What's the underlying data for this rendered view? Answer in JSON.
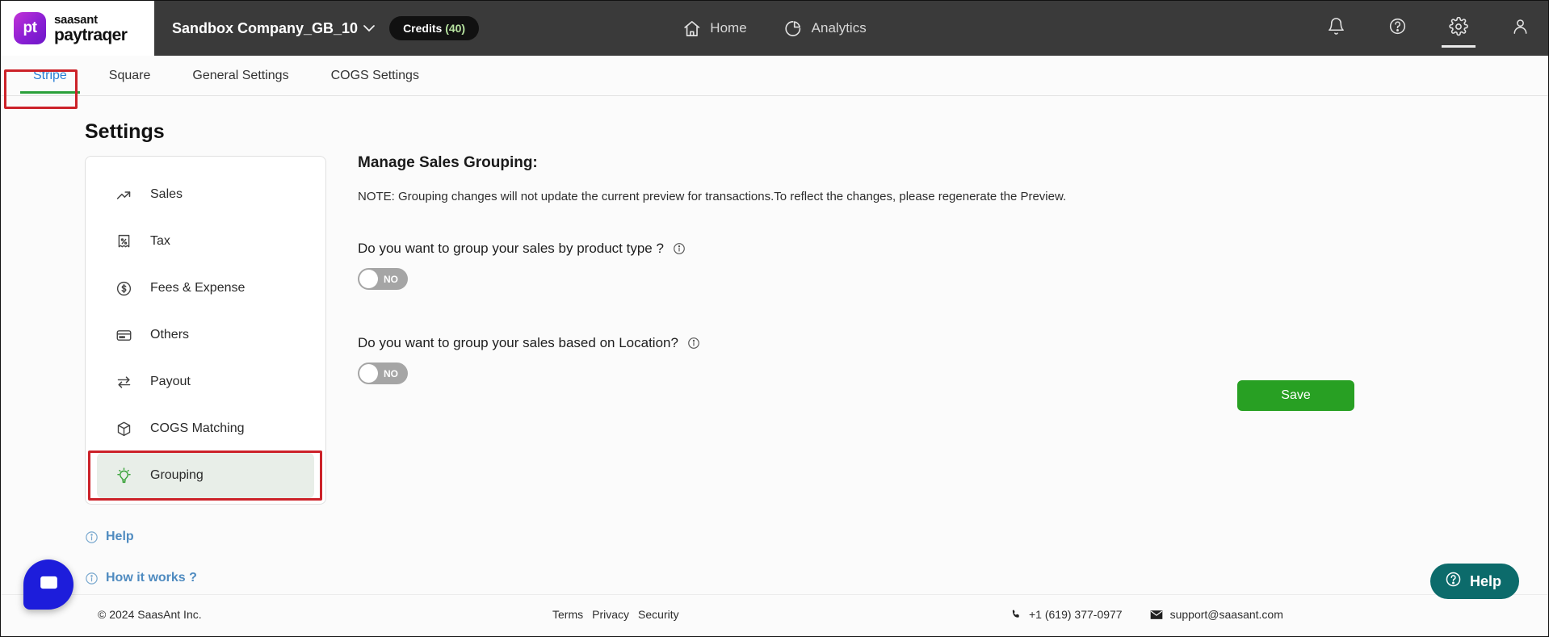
{
  "topbar": {
    "logo_mark": "pt",
    "logo_line1": "saasant",
    "logo_line2": "paytraqer",
    "company": "Sandbox Company_GB_10",
    "company_chevron": "chevron-down",
    "credits_label": "Credits",
    "credits_count": "(40)",
    "nav": [
      {
        "label": "Home",
        "icon": "home-icon"
      },
      {
        "label": "Analytics",
        "icon": "pie-chart-icon"
      }
    ],
    "right_icons": [
      {
        "name": "bell-icon",
        "active": false
      },
      {
        "name": "help-circle-icon",
        "active": false
      },
      {
        "name": "gear-icon",
        "active": true
      },
      {
        "name": "user-icon",
        "active": false
      }
    ]
  },
  "tabs": [
    {
      "label": "Stripe",
      "active": true,
      "highlighted": true
    },
    {
      "label": "Square",
      "active": false,
      "highlighted": false
    },
    {
      "label": "General Settings",
      "active": false,
      "highlighted": false
    },
    {
      "label": "COGS Settings",
      "active": false,
      "highlighted": false
    }
  ],
  "page": {
    "title": "Settings"
  },
  "sidebar": {
    "items": [
      {
        "label": "Sales",
        "icon": "trending-up-icon",
        "selected": false
      },
      {
        "label": "Tax",
        "icon": "receipt-percent-icon",
        "selected": false
      },
      {
        "label": "Fees & Expense",
        "icon": "dollar-circle-icon",
        "selected": false
      },
      {
        "label": "Others",
        "icon": "card-icon",
        "selected": false
      },
      {
        "label": "Payout",
        "icon": "transfer-arrows-icon",
        "selected": false
      },
      {
        "label": "COGS Matching",
        "icon": "box-icon",
        "selected": false
      },
      {
        "label": "Grouping",
        "icon": "lightbulb-icon",
        "selected": true
      }
    ],
    "links": [
      {
        "label": "Help",
        "icon": "info-circle-icon"
      },
      {
        "label": "How it works ?",
        "icon": "info-circle-icon"
      }
    ]
  },
  "main": {
    "heading": "Manage Sales Grouping:",
    "note": "NOTE: Grouping changes will not update the current preview for transactions.To reflect the changes, please regenerate the Preview.",
    "questions": [
      {
        "text": "Do you want to group your sales by product type ?",
        "info_icon": "info-circle-icon",
        "toggle_value": "NO",
        "toggle_on": false
      },
      {
        "text": "Do you want to group your sales based on Location?",
        "info_icon": "info-circle-icon",
        "toggle_value": "NO",
        "toggle_on": false
      }
    ],
    "save_label": "Save"
  },
  "footer": {
    "copyright": "© 2024 SaasAnt Inc.",
    "links": [
      "Terms",
      "Privacy",
      "Security"
    ],
    "phone": "+1 (619) 377-0977",
    "phone_icon": "phone-icon",
    "email": "support@saasant.com",
    "email_icon": "mail-icon"
  },
  "widgets": {
    "chat_icon": "chat-bubble-icon",
    "help_label": "Help",
    "help_icon": "help-circle-icon"
  },
  "colors": {
    "topbar_bg": "#3a3a3a",
    "tab_active": "#2a7fd4",
    "tab_underline": "#2aa03a",
    "annotation": "#cc2229",
    "save_green": "#28a023",
    "help_teal": "#0c6b6b",
    "chat_blue": "#1d1ddb",
    "link_blue": "#4f8bc0",
    "selected_bg": "#e8eee8",
    "lightbulb_green": "#3aa33a"
  }
}
